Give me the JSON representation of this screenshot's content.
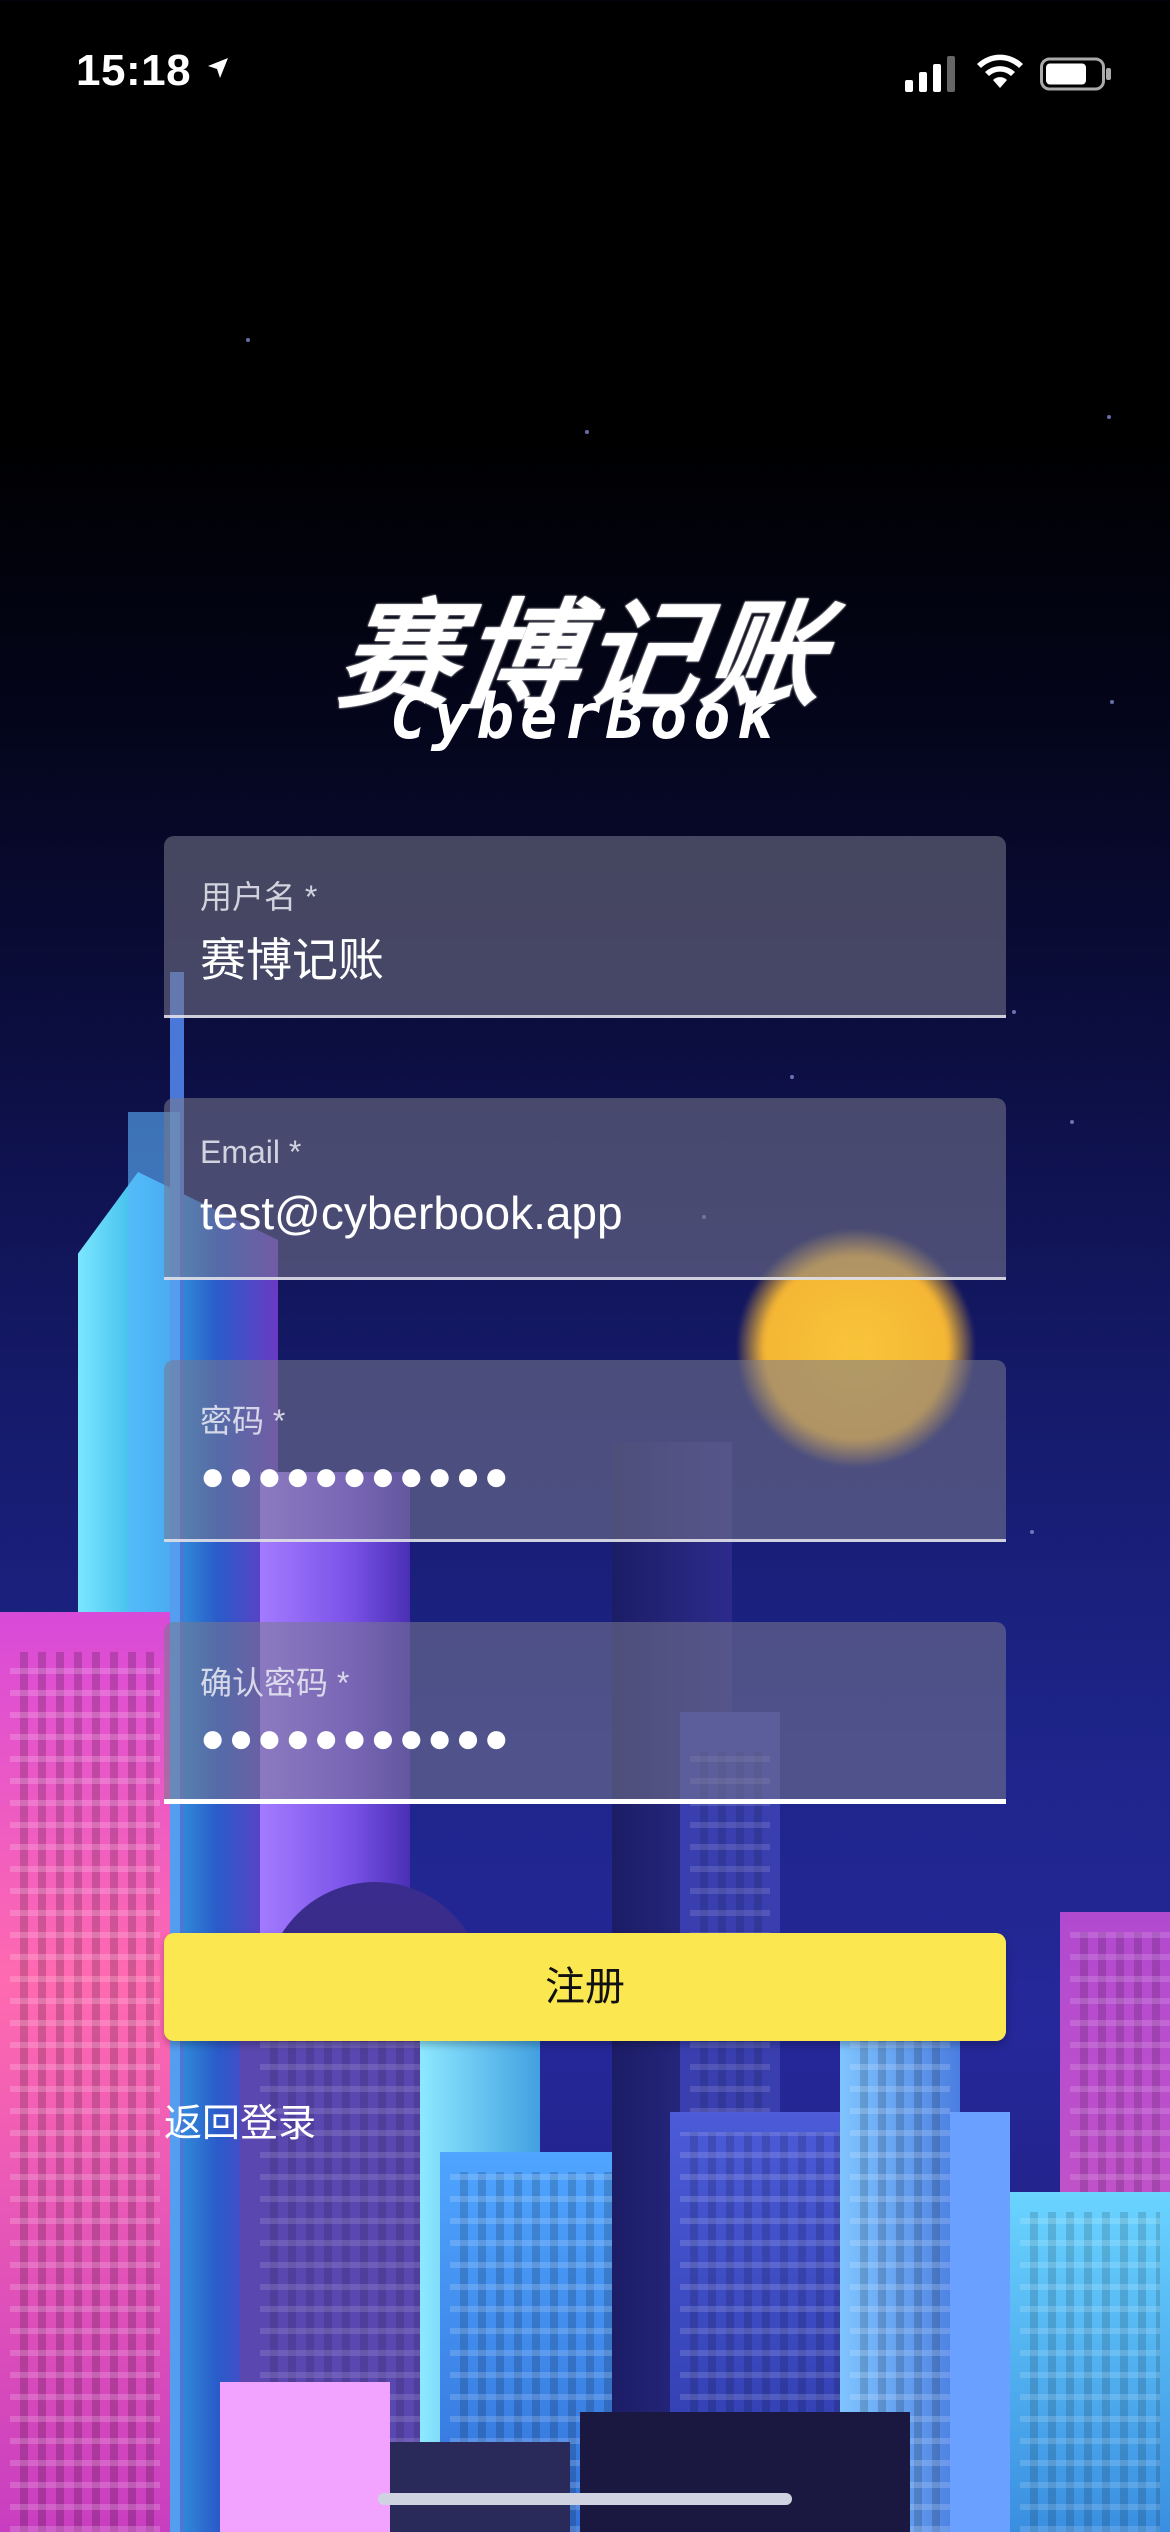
{
  "status_bar": {
    "time": "15:18",
    "icons": [
      "location-arrow-icon",
      "cellular-signal-icon",
      "wifi-icon",
      "battery-icon"
    ]
  },
  "logo": {
    "title_cn": "赛博记账",
    "title_en": "CyberBook"
  },
  "form": {
    "username": {
      "label": "用户名 *",
      "value": "赛博记账"
    },
    "email": {
      "label": "Email *",
      "value": "test@cyberbook.app"
    },
    "password": {
      "label": "密码 *",
      "value": "●●●●●●●●●●●"
    },
    "confirm_password": {
      "label": "确认密码 *",
      "value": "●●●●●●●●●●●"
    }
  },
  "actions": {
    "register": "注册",
    "back_to_login": "返回登录"
  },
  "colors": {
    "button": "#fbe850",
    "background_top": "#000000",
    "background_bottom": "#1d2488"
  }
}
